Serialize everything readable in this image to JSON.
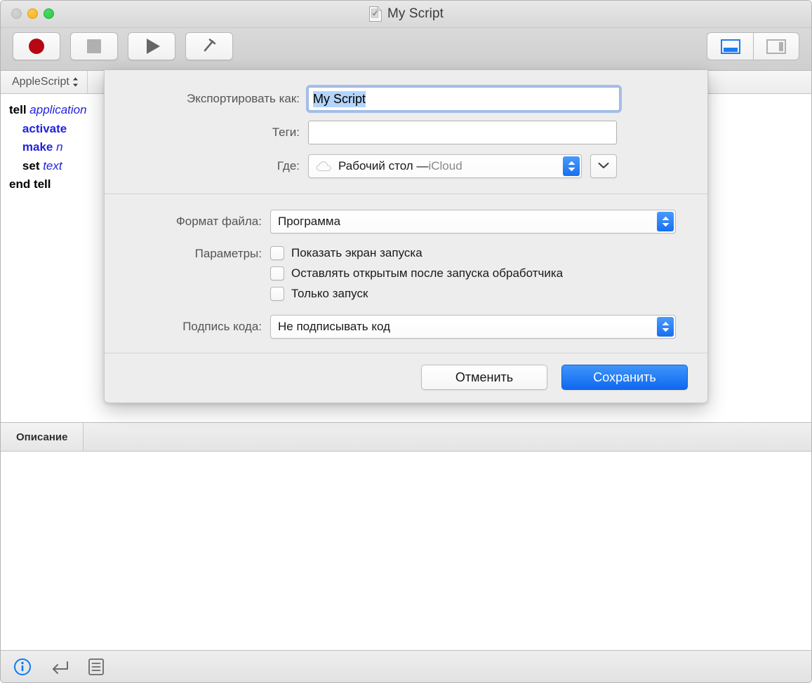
{
  "window": {
    "title": "My Script",
    "doc_icon": "script-document-icon",
    "traffic_lights": [
      {
        "name": "close",
        "color": "#c9c9c9"
      },
      {
        "name": "minimize",
        "color": "#f5b01f"
      },
      {
        "name": "maximize",
        "color": "#26c940"
      }
    ]
  },
  "toolbar": {
    "buttons": [
      {
        "name": "record",
        "icon": "record-circle-icon",
        "color": "#b60712"
      },
      {
        "name": "stop",
        "icon": "stop-square-icon",
        "color": "#b0b0b0"
      },
      {
        "name": "run",
        "icon": "play-triangle-icon",
        "color": "#666666"
      },
      {
        "name": "compile",
        "icon": "hammer-icon",
        "color": "#666666"
      }
    ],
    "view_toggles": [
      {
        "name": "bottom-panel-layout",
        "icon": "layout-bottom-icon",
        "active": true,
        "accent": "#1a7df5"
      },
      {
        "name": "side-panel-layout",
        "icon": "layout-side-icon",
        "active": false,
        "accent": "#b0b0b0"
      }
    ]
  },
  "language_bar": {
    "selected": "AppleScript",
    "icon": "chevron-updown-icon"
  },
  "editor": {
    "lines": [
      [
        {
          "t": "tell ",
          "c": "kw"
        },
        {
          "t": "application",
          "c": "ref"
        }
      ],
      [
        {
          "t": "    ",
          "c": "plain"
        },
        {
          "t": "activate",
          "c": "cmd"
        }
      ],
      [
        {
          "t": "    ",
          "c": "plain"
        },
        {
          "t": "make ",
          "c": "cmd"
        },
        {
          "t": "n",
          "c": "ref"
        }
      ],
      [
        {
          "t": "    ",
          "c": "plain"
        },
        {
          "t": "set ",
          "c": "kw"
        },
        {
          "t": "text",
          "c": "ref"
        }
      ],
      [
        {
          "t": "end tell",
          "c": "kw"
        }
      ]
    ]
  },
  "description_pane": {
    "tab_label": "Описание",
    "content": ""
  },
  "bottom_bar": {
    "icons": [
      {
        "name": "info-icon",
        "active": true,
        "color": "#0a7cf5"
      },
      {
        "name": "return-arrow-icon",
        "active": false,
        "color": "#6a6a6a"
      },
      {
        "name": "log-list-icon",
        "active": false,
        "color": "#6a6a6a"
      }
    ]
  },
  "save_sheet": {
    "export_as": {
      "label": "Экспортировать как:",
      "value": "My Script",
      "selected": true
    },
    "tags": {
      "label": "Теги:",
      "value": "",
      "placeholder": ""
    },
    "where": {
      "label": "Где:",
      "value": "Рабочий стол — iCloud",
      "value_main": "Рабочий стол — ",
      "value_suffix": "iCloud",
      "icon": "icloud-cloud-icon",
      "expand_icon": "chevron-down-icon"
    },
    "file_format": {
      "label": "Формат файла:",
      "value": "Программа"
    },
    "options": {
      "label": "Параметры:",
      "items": [
        {
          "label": "Показать экран запуска",
          "checked": false
        },
        {
          "label": "Оставлять открытым после запуска обработчика",
          "checked": false
        },
        {
          "label": "Только запуск",
          "checked": false
        }
      ]
    },
    "code_signature": {
      "label": "Подпись кода:",
      "value": "Не подписывать код"
    },
    "actions": {
      "cancel": "Отменить",
      "save": "Сохранить"
    },
    "accent_color": "#1670f0",
    "selection_color": "#b4d4fb"
  }
}
